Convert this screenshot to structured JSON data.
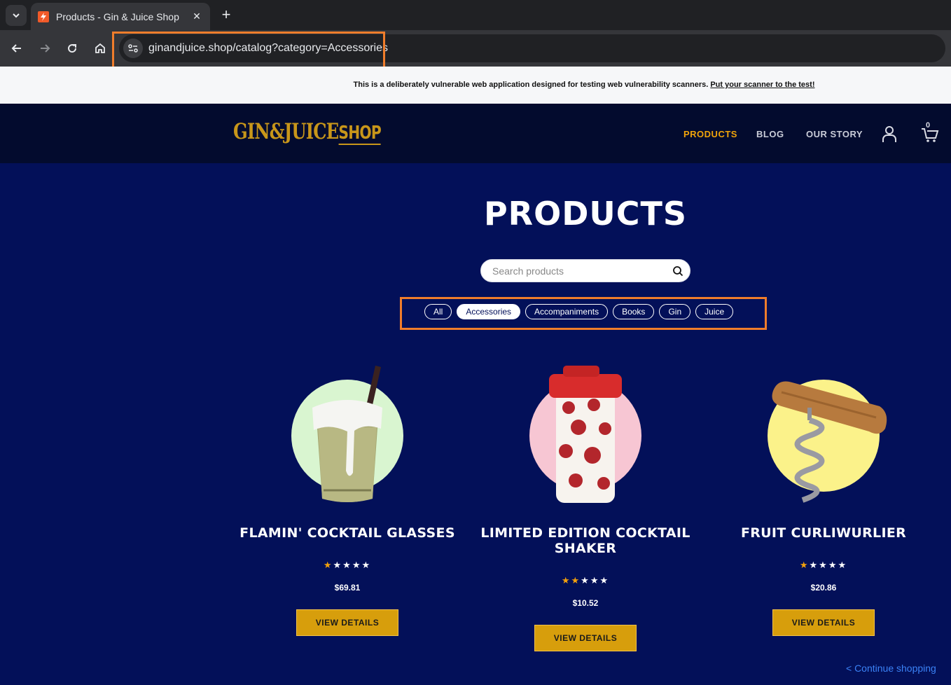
{
  "browser": {
    "tab_title": "Products - Gin & Juice Shop",
    "url": "ginandjuice.shop/catalog?category=Accessories"
  },
  "banner": {
    "text": "This is a deliberately vulnerable web application designed for testing web vulnerability scanners.",
    "link": "Put your scanner to the test!"
  },
  "header": {
    "logo_main": "GIN&JUICE",
    "logo_shop": "SHOP",
    "nav": [
      "PRODUCTS",
      "BLOG",
      "OUR STORY"
    ],
    "cart_count": "0"
  },
  "main": {
    "title": "PRODUCTS",
    "search_placeholder": "Search products",
    "filters": [
      "All",
      "Accessories",
      "Accompaniments",
      "Books",
      "Gin",
      "Juice"
    ],
    "active_filter": "Accessories",
    "products": [
      {
        "name": "FLAMIN' COCKTAIL GLASSES",
        "rating": 1,
        "max_rating": 5,
        "price": "$69.81",
        "button": "VIEW DETAILS",
        "bg_color": "#d9f5d0"
      },
      {
        "name": "LIMITED EDITION COCKTAIL SHAKER",
        "rating": 2,
        "max_rating": 5,
        "price": "$10.52",
        "button": "VIEW DETAILS",
        "bg_color": "#f7c6d3"
      },
      {
        "name": "FRUIT CURLIWURLIER",
        "rating": 1,
        "max_rating": 5,
        "price": "$20.86",
        "button": "VIEW DETAILS",
        "bg_color": "#fbf28a"
      }
    ],
    "continue_link": "< Continue shopping"
  },
  "colors": {
    "page_bg": "#031059",
    "header_bg": "#030b2e",
    "accent": "#d79e0c",
    "highlight": "#f07d2b"
  }
}
